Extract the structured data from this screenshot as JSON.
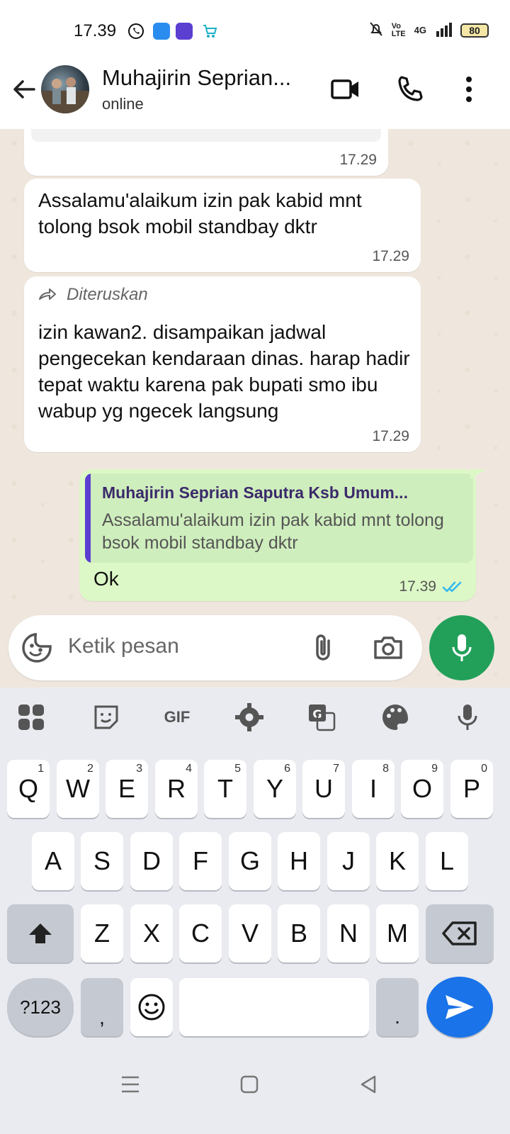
{
  "status_bar": {
    "time": "17.39",
    "battery": "80",
    "network": "4G"
  },
  "header": {
    "contact_name": "Muhajirin Seprian...",
    "status": "online"
  },
  "messages": [
    {
      "type": "in",
      "text": "",
      "time": "17.29"
    },
    {
      "type": "in",
      "text": "Assalamu'alaikum izin pak kabid mnt tolong bsok mobil standbay dktr",
      "time": "17.29"
    },
    {
      "type": "in",
      "forwarded_label": "Diteruskan",
      "text": "izin kawan2. disampaikan jadwal pengecekan kendaraan dinas. harap hadir tepat waktu karena pak bupati smo ibu wabup yg ngecek langsung",
      "time": "17.29"
    },
    {
      "type": "out",
      "quote_name": "Muhajirin Seprian Saputra Ksb Umum...",
      "quote_text": "Assalamu'alaikum izin pak kabid mnt tolong bsok mobil standbay dktr",
      "text": "Ok",
      "time": "17.39"
    }
  ],
  "input": {
    "placeholder": "Ketik pesan"
  },
  "keyboard": {
    "gif_label": "GIF",
    "row1": [
      {
        "k": "Q",
        "n": "1"
      },
      {
        "k": "W",
        "n": "2"
      },
      {
        "k": "E",
        "n": "3"
      },
      {
        "k": "R",
        "n": "4"
      },
      {
        "k": "T",
        "n": "5"
      },
      {
        "k": "Y",
        "n": "6"
      },
      {
        "k": "U",
        "n": "7"
      },
      {
        "k": "I",
        "n": "8"
      },
      {
        "k": "O",
        "n": "9"
      },
      {
        "k": "P",
        "n": "0"
      }
    ],
    "row2": [
      "A",
      "S",
      "D",
      "F",
      "G",
      "H",
      "J",
      "K",
      "L"
    ],
    "row3": [
      "Z",
      "X",
      "C",
      "V",
      "B",
      "N",
      "M"
    ],
    "symbols_label": "?123",
    "comma": ",",
    "period": "."
  },
  "colors": {
    "chat_bg": "#efe7dd",
    "outgoing_bubble": "#dcf8c6",
    "mic_button": "#22a05a",
    "send_key": "#1a73e8",
    "read_ticks": "#34b7f1"
  }
}
